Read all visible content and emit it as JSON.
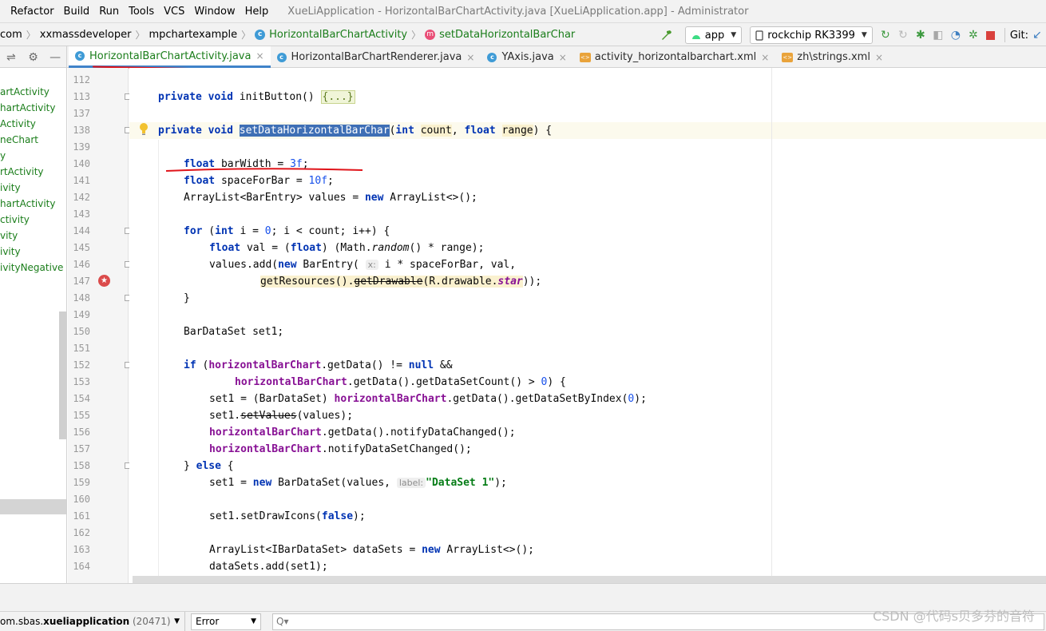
{
  "menu": [
    "Refactor",
    "Build",
    "Run",
    "Tools",
    "VCS",
    "Window",
    "Help"
  ],
  "window_title": "XueLiApplication - HorizontalBarChartActivity.java [XueLiApplication.app] - Administrator",
  "breadcrumbs": [
    "com",
    "xxmassdeveloper",
    "mpchartexample",
    "HorizontalBarChartActivity",
    "setDataHorizontalBarChar"
  ],
  "toolbar": {
    "run_config": "app",
    "device": "rockchip RK3399",
    "git_label": "Git:"
  },
  "tabs": [
    {
      "label": "HorizontalBarChartActivity.java",
      "active": true,
      "icon": "class-icon"
    },
    {
      "label": "HorizontalBarChartRenderer.java",
      "active": false,
      "icon": "class-icon"
    },
    {
      "label": "YAxis.java",
      "active": false,
      "icon": "class-icon"
    },
    {
      "label": "activity_horizontalbarchart.xml",
      "active": false,
      "icon": "xml-icon"
    },
    {
      "label": "zh\\strings.xml",
      "active": false,
      "icon": "xml-icon"
    }
  ],
  "sidebar": {
    "items": [
      "artActivity",
      "hartActivity",
      "Activity",
      "neChart",
      "y",
      "rtActivity",
      "ivity",
      "hartActivity",
      "ctivity",
      "vity",
      "ivity",
      "ivityNegative"
    ]
  },
  "editor": {
    "line_numbers": [
      "112",
      "113",
      "137",
      "138",
      "139",
      "140",
      "141",
      "142",
      "143",
      "144",
      "145",
      "146",
      "147",
      "148",
      "149",
      "150",
      "151",
      "152",
      "153",
      "154",
      "155",
      "156",
      "157",
      "158",
      "159",
      "160",
      "161",
      "162",
      "163",
      "164"
    ],
    "code": {
      "l113_kw": "private void",
      "l113_rest": " initButton() ",
      "l113_fold": "{...}",
      "l138_kw": "private void",
      "l138_method": "setDataHorizontalBarChar",
      "l138_p1": "(",
      "l138_int": "int",
      "l138_count": "count",
      "l138_comma": ", ",
      "l138_float": "float",
      "l138_range": "range",
      "l138_end": ") {",
      "l140_kw": "float",
      "l140_rest": " barWidth = ",
      "l140_num": "3f",
      "l140_end": ";",
      "l141_kw": "float",
      "l141_rest": " spaceForBar = ",
      "l141_num": "10f",
      "l141_end": ";",
      "l142_a": "ArrayList<BarEntry> values = ",
      "l142_kw": "new",
      "l142_b": " ArrayList<>();",
      "l144_kw1": "for",
      "l144_a": " (",
      "l144_kw2": "int",
      "l144_b": " i = ",
      "l144_num": "0",
      "l144_c": "; i < count; i++) {",
      "l145_kw1": "float",
      "l145_a": " val = (",
      "l145_kw2": "float",
      "l145_b": ") (Math.",
      "l145_random": "random",
      "l145_c": "() * range);",
      "l146_a": "values.add(",
      "l146_kw": "new",
      "l146_b": " BarEntry( ",
      "l146_hint": "x:",
      "l146_c": " i * spaceForBar, val,",
      "l147_a": "getResources().",
      "l147_strike": "getDrawable",
      "l147_b": "(R.drawable.",
      "l147_star": "star",
      "l147_c": "));",
      "l148": "}",
      "l150": "BarDataSet set1;",
      "l152_kw1": "if",
      "l152_a": " (",
      "l152_fld": "horizontalBarChart",
      "l152_b": ".getData() != ",
      "l152_kw2": "null",
      "l152_c": " &&",
      "l153_fld": "horizontalBarChart",
      "l153_a": ".getData().getDataSetCount() > ",
      "l153_num": "0",
      "l153_b": ") {",
      "l154_a": "set1 = (BarDataSet) ",
      "l154_fld": "horizontalBarChart",
      "l154_b": ".getData().getDataSetByIndex(",
      "l154_num": "0",
      "l154_c": ");",
      "l155_a": "set1.",
      "l155_strike": "setValues",
      "l155_b": "(values);",
      "l156_fld": "horizontalBarChart",
      "l156_a": ".getData().notifyDataChanged();",
      "l157_fld": "horizontalBarChart",
      "l157_a": ".notifyDataSetChanged();",
      "l158_a": "} ",
      "l158_kw": "else",
      "l158_b": " {",
      "l159_a": "set1 = ",
      "l159_kw": "new",
      "l159_b": " BarDataSet(values, ",
      "l159_hint": "label:",
      "l159_str": "\"DataSet 1\"",
      "l159_c": ");",
      "l161_a": "set1.setDrawIcons(",
      "l161_kw": "false",
      "l161_b": ");",
      "l163_a": "ArrayList<IBarDataSet> dataSets = ",
      "l163_kw": "new",
      "l163_b": " ArrayList<>();",
      "l164": "dataSets.add(set1);"
    }
  },
  "logcat": {
    "process_prefix": "om.sbas.",
    "process_name": "xueliapplication",
    "pid": "(20471)",
    "level": "Error",
    "search_icon": "Q▾"
  },
  "watermark": "CSDN @代码s贝多芬的音符",
  "colors": {
    "keyword": "#0033b3",
    "number": "#1750eb",
    "string": "#067d17",
    "field": "#871094",
    "selection": "#3e6fb5",
    "annotation_red": "#e0141a"
  }
}
